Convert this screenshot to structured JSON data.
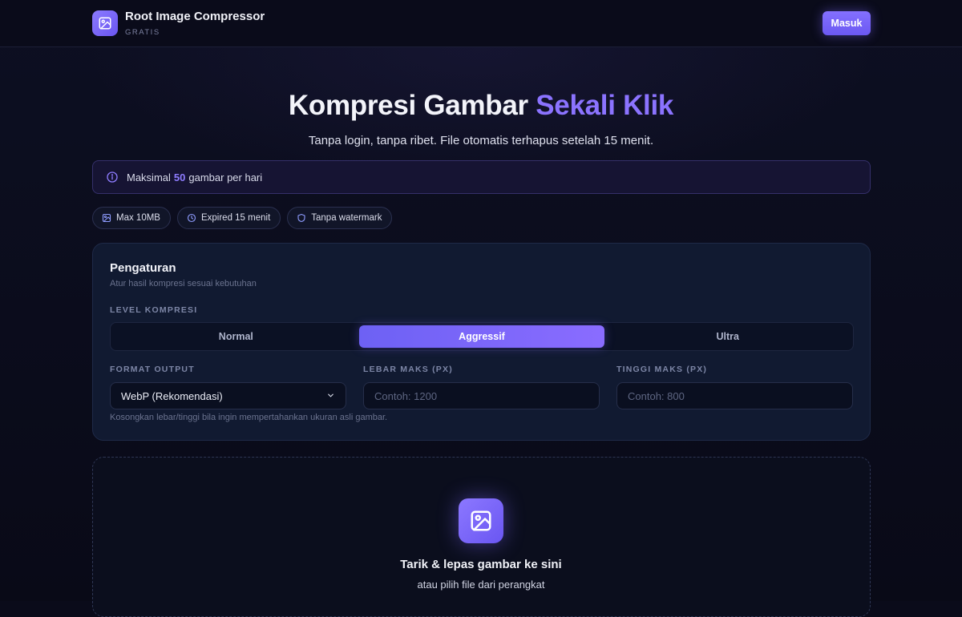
{
  "header": {
    "app_name": "Root Image Compressor",
    "app_tag": "GRATIS",
    "login_label": "Masuk"
  },
  "hero": {
    "title_main": "Kompresi Gambar ",
    "title_accent": "Sekali Klik",
    "subtitle": "Tanpa login, tanpa ribet. File otomatis terhapus setelah 15 menit."
  },
  "notice": {
    "prefix": "Maksimal",
    "count": "50",
    "suffix": "gambar per hari"
  },
  "chips": [
    {
      "icon": "image-icon",
      "label": "Max 10MB"
    },
    {
      "icon": "clock-icon",
      "label": "Expired 15 menit"
    },
    {
      "icon": "shield-icon",
      "label": "Tanpa watermark"
    }
  ],
  "settings": {
    "title": "Pengaturan",
    "subtitle": "Atur hasil kompresi sesuai kebutuhan",
    "level_label": "LEVEL KOMPRESI",
    "levels": [
      "Normal",
      "Aggressif",
      "Ultra"
    ],
    "selected_level": "Aggressif",
    "format_label": "FORMAT OUTPUT",
    "format_value": "WebP (Rekomendasi)",
    "width_label": "LEBAR MAKS (PX)",
    "width_placeholder": "Contoh: 1200",
    "height_label": "TINGGI MAKS (PX)",
    "height_placeholder": "Contoh: 800",
    "hint": "Kosongkan lebar/tinggi bila ingin mempertahankan ukuran asli gambar."
  },
  "dropzone": {
    "title": "Tarik & lepas gambar ke sini",
    "subtitle": "atau pilih file dari perangkat"
  },
  "colors": {
    "accent": "#8b73ff",
    "background": "#0a0b1a",
    "panel": "#111a31"
  }
}
